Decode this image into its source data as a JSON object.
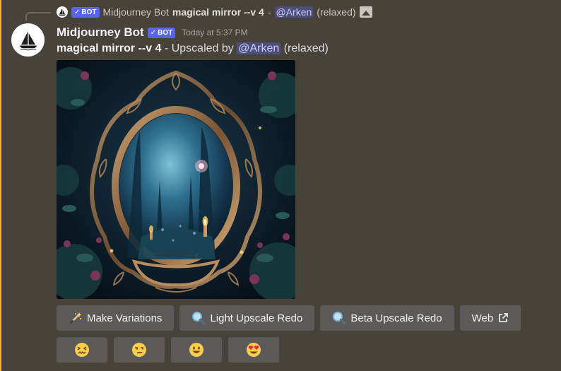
{
  "reply": {
    "username": "Midjourney Bot",
    "bot_tag": "BOT",
    "prompt": "magical mirror --v 4",
    "separator": " - ",
    "mention": "@Arken",
    "mode": "(relaxed)"
  },
  "message": {
    "username": "Midjourney Bot",
    "bot_tag": "BOT",
    "timestamp": "Today at 5:37 PM",
    "prompt": "magical mirror --v 4",
    "upscaled_text": " - Upscaled by ",
    "mention": "@Arken",
    "mode": "(relaxed)"
  },
  "buttons": [
    {
      "label": "Make Variations",
      "icon": "magic-wand-icon"
    },
    {
      "label": "Light Upscale Redo",
      "icon": "magnifier-icon"
    },
    {
      "label": "Beta Upscale Redo",
      "icon": "magnifier-icon"
    },
    {
      "label": "Web",
      "icon": "external-link-icon"
    }
  ],
  "reactions": [
    {
      "icon": "confounded-face-icon"
    },
    {
      "icon": "unamused-face-icon"
    },
    {
      "icon": "smiling-face-icon"
    },
    {
      "icon": "heart-eyes-face-icon"
    }
  ],
  "colors": {
    "background": "#47423a",
    "accent": "#f0b232",
    "bot_tag": "#5865f2",
    "button": "#5b5a58",
    "mention_bg": "#5865f2"
  }
}
